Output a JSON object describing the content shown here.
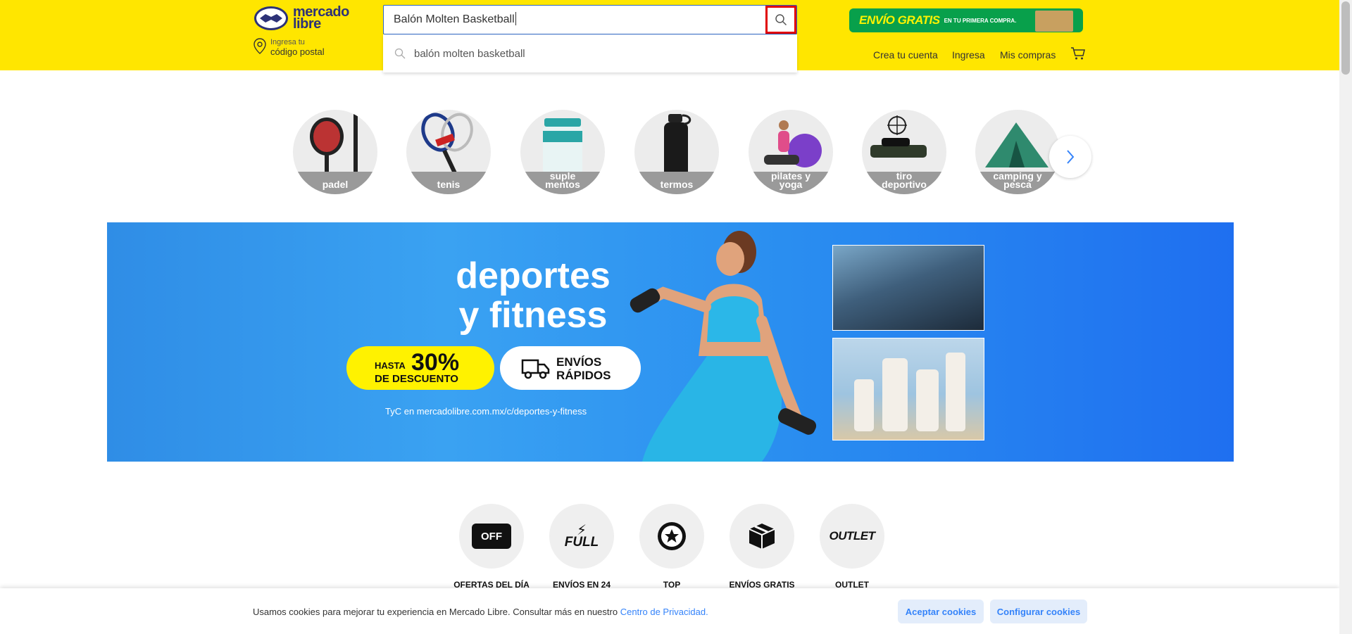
{
  "header": {
    "logo_line1": "mercado",
    "logo_line2": "libre",
    "postal_small": "Ingresa tu",
    "postal_big": "código postal",
    "search_value": "Balón Molten Basketball",
    "suggestion": "balón molten basketball",
    "promo_main": "ENVÍO GRATIS",
    "promo_sub": "EN TU PRIMERA COMPRA.",
    "nav": [
      "Crea tu cuenta",
      "Ingresa",
      "Mis compras"
    ]
  },
  "categories": [
    "padel",
    "tenis",
    "suple mentos",
    "termos",
    "pilates y yoga",
    "tiro deportivo",
    "camping y pesca"
  ],
  "banner": {
    "title_line1": "deportes",
    "title_line2": "y fitness",
    "discount_hasta": "HASTA",
    "discount_value": "30%",
    "discount_desc": "DE DESCUENTO",
    "shipping_line1": "ENVÍOS",
    "shipping_line2": "RÁPIDOS",
    "tyc": "TyC en mercadolibre.com.mx/c/deportes-y-fitness"
  },
  "shortcuts": [
    "OFERTAS DEL DÍA",
    "ENVÍOS EN 24",
    "TOP",
    "ENVÍOS GRATIS",
    "OUTLET"
  ],
  "shortcut_icon_text": {
    "off": "OFF",
    "full": "FULL",
    "outlet": "OUTLET"
  },
  "cookies": {
    "text": "Usamos cookies para mejorar tu experiencia en Mercado Libre. Consultar más en nuestro ",
    "link": "Centro de Privacidad.",
    "accept": "Aceptar cookies",
    "configure": "Configurar cookies"
  },
  "colors": {
    "brand_yellow": "#ffe600",
    "brand_blue": "#2d3277",
    "link_blue": "#3483fa",
    "focus_red": "#e00000"
  }
}
